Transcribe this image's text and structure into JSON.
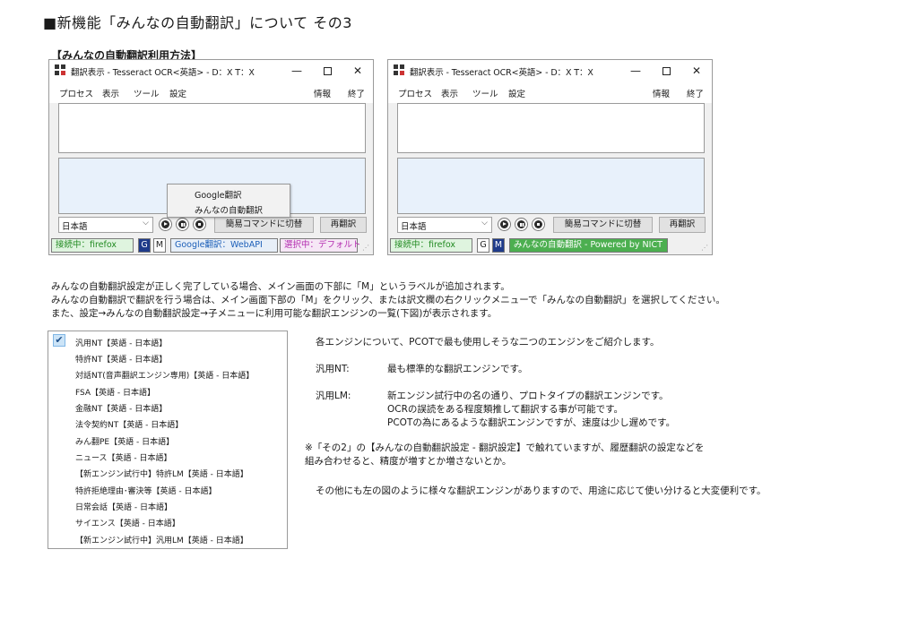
{
  "page": {
    "title": "■新機能「みんなの自動翻訳」について その3",
    "section_heading": "【みんなの自動翻訳利用方法】"
  },
  "windows": [
    {
      "title": "翻訳表示 - Tesseract OCR<英語> - D：X T：X",
      "menu": [
        "プロセス",
        "表示",
        "ツール",
        "設定",
        "情報",
        "終了"
      ],
      "language": "日本語",
      "buttons": {
        "simple": "簡易コマンドに切替",
        "retranslate": "再翻訳"
      },
      "status": {
        "connection": "接続中：firefox",
        "g": "G",
        "m": "M",
        "engine": "Google翻訳：WebAPI",
        "selection": "選択中：デフォルト"
      },
      "context_menu": [
        "Google翻訳",
        "みんなの自動翻訳"
      ]
    },
    {
      "title": "翻訳表示 - Tesseract OCR<英語> - D：X T：X",
      "menu": [
        "プロセス",
        "表示",
        "ツール",
        "設定",
        "情報",
        "終了"
      ],
      "language": "日本語",
      "buttons": {
        "simple": "簡易コマンドに切替",
        "retranslate": "再翻訳"
      },
      "status": {
        "connection": "接続中：firefox",
        "g": "G",
        "m": "M",
        "engine": "みんなの自動翻訳 - Powered by NICT"
      }
    }
  ],
  "title_controls": {
    "minimize": "—",
    "close": "✕"
  },
  "description": [
    "みんなの自動翻訳設定が正しく完了している場合、メイン画面の下部に「M」というラベルが追加されます。",
    "みんなの自動翻訳で翻訳を行う場合は、メイン画面下部の「M」をクリック、または訳文欄の右クリックメニューで「みんなの自動翻訳」を選択してください。",
    "また、設定→みんなの自動翻訳設定→子メニューに利用可能な翻訳エンジンの一覧(下図)が表示されます。"
  ],
  "engines": [
    "汎用NT【英語 - 日本語】",
    "特許NT【英語 - 日本語】",
    "対話NT(音声翻訳エンジン専用)【英語 - 日本語】",
    "FSA【英語 - 日本語】",
    "金融NT【英語 - 日本語】",
    "法令契約NT【英語 - 日本語】",
    "みん翻PE【英語 - 日本語】",
    "ニュース【英語 - 日本語】",
    "【新エンジン試行中】特許LM【英語 - 日本語】",
    "特許拒絶理由･審決等【英語 - 日本語】",
    "日常会話【英語 - 日本語】",
    "サイエンス【英語 - 日本語】",
    "【新エンジン試行中】汎用LM【英語 - 日本語】"
  ],
  "checked_engine_mark": "✔",
  "explanation": {
    "intro": "各エンジンについて、PCOTで最も使用しそうな二つのエンジンをご紹介します。",
    "nt_label": "汎用NT:",
    "nt_text": "最も標準的な翻訳エンジンです。",
    "lm_label": "汎用LM:",
    "lm_lines": [
      "新エンジン試行中の名の通り、プロトタイプの翻訳エンジンです。",
      "OCRの誤読をある程度類推して翻訳する事が可能です。",
      "PCOTの為にあるような翻訳エンジンですが、速度は少し遅めです。"
    ],
    "note_lines": [
      "※「その2」の【みんなの自動翻訳設定 - 翻訳設定】で触れていますが、履歴翻訳の設定などを",
      "組み合わせると、精度が増すとか増さないとか。"
    ],
    "closing": "その他にも左の図のように様々な翻訳エンジンがありますので、用途に応じて使い分けると大変便利です。"
  }
}
